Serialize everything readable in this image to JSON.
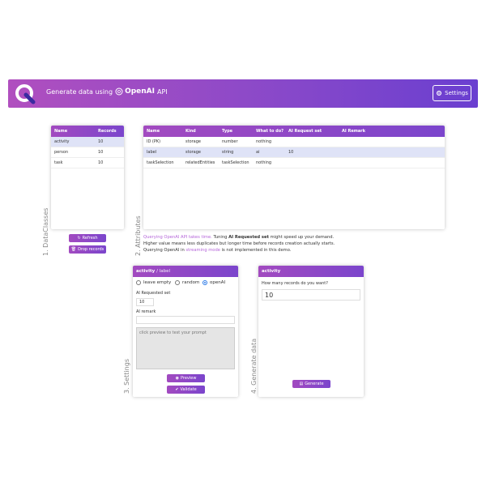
{
  "header": {
    "title_prefix": "Generate data using",
    "brand": "OpenAI",
    "title_suffix": "API",
    "settings_label": "Settings"
  },
  "dataclasses": {
    "columns": [
      "Name",
      "Records"
    ],
    "rows": [
      {
        "name": "activity",
        "records": "10",
        "selected": true
      },
      {
        "name": "person",
        "records": "10",
        "selected": false
      },
      {
        "name": "task",
        "records": "10",
        "selected": false
      }
    ],
    "section_label": "1. DataClasses",
    "refresh_label": "Refresh",
    "drop_label": "Drop records"
  },
  "attributes": {
    "columns": [
      "Name",
      "Kind",
      "Type",
      "What to do?",
      "AI Request set",
      "AI Remark"
    ],
    "rows": [
      {
        "name": "ID (PK)",
        "kind": "storage",
        "type": "number",
        "todo": "nothing",
        "request": "",
        "remark": "",
        "selected": false
      },
      {
        "name": "label",
        "kind": "storage",
        "type": "string",
        "todo": "ai",
        "request": "10",
        "remark": "",
        "selected": true
      },
      {
        "name": "taskSelection",
        "kind": "relatedEntities",
        "type": "taskSelection",
        "todo": "nothing",
        "request": "",
        "remark": "",
        "selected": false
      }
    ],
    "section_label": "2. Attributes"
  },
  "info": {
    "line1_link": "Querying OpenAI API takes time.",
    "line1_mid": " Tuning ",
    "line1_bold": "AI Requested set",
    "line1_end": " might speed up your demand.",
    "line2": "Higher value means less duplicates but longer time before records creation actually starts.",
    "line3_start": "Querying OpenAI in ",
    "line3_link": "streaming mode",
    "line3_end": " is not implemented in this demo."
  },
  "settings": {
    "section_label": "3. Settings",
    "head_entity": "activity",
    "head_attr": "/ label",
    "radios": [
      {
        "label": "leave empty",
        "checked": false
      },
      {
        "label": "random",
        "checked": false
      },
      {
        "label": "openAI",
        "checked": true
      }
    ],
    "requested_label": "AI Requested set",
    "requested_value": "10",
    "remark_label": "AI remark",
    "remark_value": "",
    "prompt_placeholder": "click preview to test your prompt",
    "preview_label": "Preview",
    "validate_label": "Validate"
  },
  "generate": {
    "section_label": "4. Generate data",
    "head": "activity",
    "question": "How many records do you want?",
    "count": "10",
    "button_label": "Generate"
  },
  "colors": {
    "accent_start": "#a24ac0",
    "accent_end": "#7b45cc",
    "selected_row": "#dfe3f7",
    "link": "#b566d9"
  }
}
